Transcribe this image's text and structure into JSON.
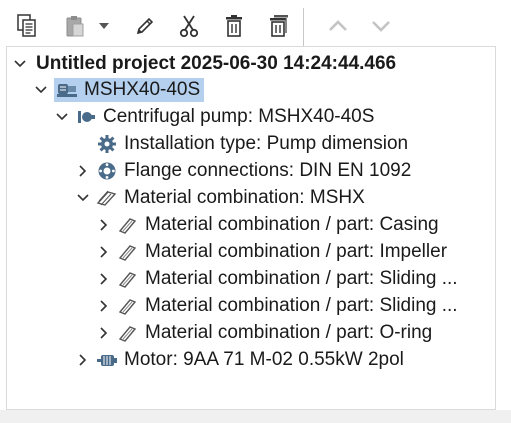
{
  "toolbar": {
    "buttons": [
      {
        "name": "copy-button",
        "icon": "copy-icon"
      },
      {
        "name": "paste-button",
        "icon": "paste-icon"
      },
      {
        "name": "paste-dropdown-button",
        "icon": "chevron-down-icon"
      },
      {
        "name": "edit-button",
        "icon": "pencil-icon"
      },
      {
        "name": "cut-button",
        "icon": "scissors-icon"
      },
      {
        "name": "delete-button",
        "icon": "trash-icon"
      },
      {
        "name": "delete-all-button",
        "icon": "trash-stack-icon"
      },
      {
        "name": "move-up-button",
        "icon": "chevron-up-icon"
      },
      {
        "name": "move-down-button",
        "icon": "chevron-down-icon"
      }
    ]
  },
  "tree": {
    "project": {
      "label": "Untitled project 2025-06-30 14:24:44.466"
    },
    "item": {
      "label": "MSHX40-40S"
    },
    "pump": {
      "label": "Centrifugal pump: MSHX40-40S"
    },
    "installation": {
      "label": "Installation type: Pump dimension"
    },
    "flange": {
      "label": "Flange connections: DIN EN 1092"
    },
    "material": {
      "label": "Material combination: MSHX"
    },
    "parts": [
      {
        "label": "Material combination / part: Casing"
      },
      {
        "label": "Material combination / part: Impeller"
      },
      {
        "label": "Material combination / part: Sliding ..."
      },
      {
        "label": "Material combination / part: Sliding ..."
      },
      {
        "label": "Material combination / part: O-ring"
      }
    ],
    "motor": {
      "label": "Motor: 9AA 71 M-02 0.55kW 2pol"
    }
  },
  "colors": {
    "selection": "#b4d0ee",
    "icon": "#4a6a8a",
    "disabled": "#c4c4c4"
  }
}
